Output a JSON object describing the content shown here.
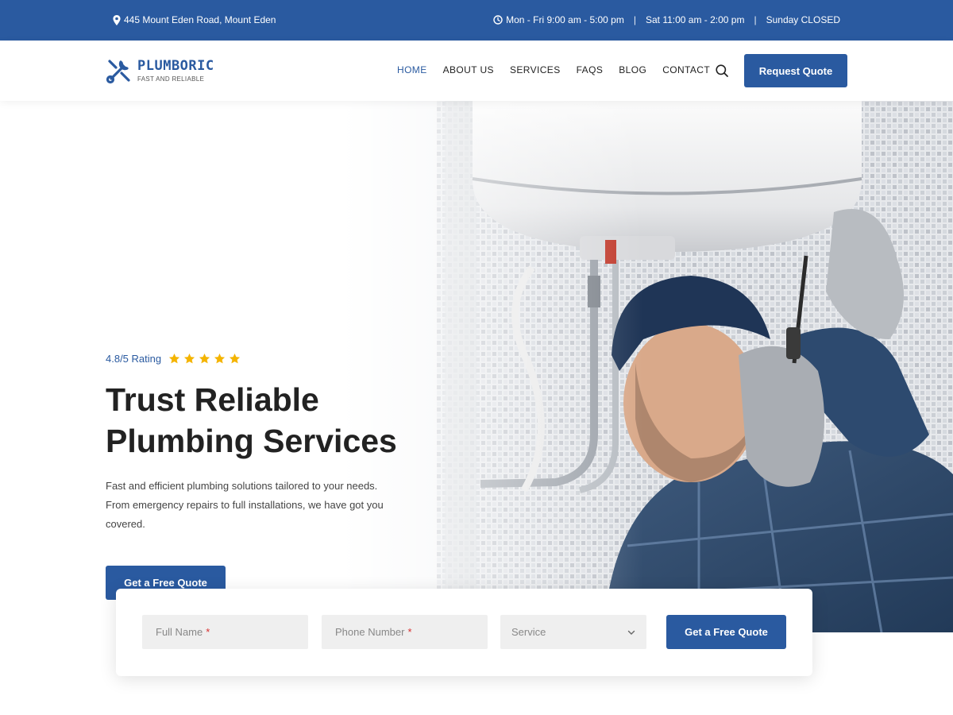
{
  "topbar": {
    "address": "445 Mount Eden Road, Mount Eden",
    "hours_weekday": "Mon - Fri 9:00 am - 5:00 pm",
    "hours_saturday": "Sat 11:00 am - 2:00 pm",
    "hours_sunday": "Sunday CLOSED",
    "separator": "|"
  },
  "brand": {
    "name": "PLUMBORIC",
    "tagline": "FAST AND RELIABLE",
    "primary_color": "#2a5aa0",
    "star_color": "#f4b400"
  },
  "nav": {
    "items": [
      "HOME",
      "ABOUT US",
      "SERVICES",
      "FAQS",
      "BLOG",
      "CONTACT"
    ],
    "active": "HOME",
    "cta_label": "Request Quote"
  },
  "hero": {
    "rating_text": "4.8/5 Rating",
    "rating_stars": 5,
    "title_line1": "Trust Reliable",
    "title_line2": "Plumbing Services",
    "description": "Fast and efficient plumbing solutions tailored to your needs. From emergency repairs to full installations, we have got you covered.",
    "cta_label": "Get a Free Quote"
  },
  "quote_form": {
    "full_name_placeholder": "Full Name",
    "phone_placeholder": "Phone Number",
    "required_mark": "*",
    "service_selected": "Service",
    "submit_label": "Get a Free Quote"
  },
  "icons": {
    "address": "map-pin-icon",
    "hours": "clock-icon",
    "logo": "wrench-screwdriver-icon",
    "search": "search-icon",
    "rating": "star-icon",
    "dropdown": "chevron-down-icon"
  }
}
